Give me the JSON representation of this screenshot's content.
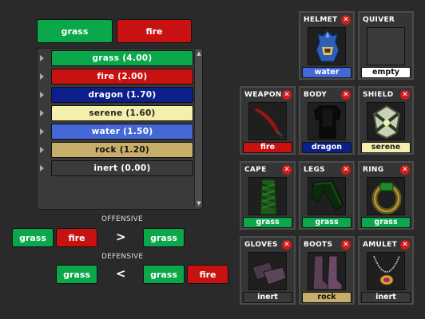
{
  "top_buttons": [
    {
      "label": "grass",
      "color": "#0aa84b"
    },
    {
      "label": "fire",
      "color": "#c81111"
    }
  ],
  "elements": [
    {
      "label": "grass (4.00)",
      "color": "#0aa84b",
      "text_color": "#ffffff"
    },
    {
      "label": "fire (2.00)",
      "color": "#c81111",
      "text_color": "#ffffff"
    },
    {
      "label": "dragon (1.70)",
      "color": "#0d1f8a",
      "text_color": "#ffffff"
    },
    {
      "label": "serene (1.60)",
      "color": "#f3efad",
      "text_color": "#222222"
    },
    {
      "label": "water (1.50)",
      "color": "#4468d8",
      "text_color": "#ffffff"
    },
    {
      "label": "rock (1.20)",
      "color": "#c7ae6a",
      "text_color": "#111111"
    },
    {
      "label": "inert (0.00)",
      "color": "#3a3a3a",
      "text_color": "#ffffff"
    }
  ],
  "offensive": {
    "label": "OFFENSIVE",
    "left": [
      "grass",
      "fire"
    ],
    "operator": ">",
    "right": [
      "grass"
    ]
  },
  "defensive": {
    "label": "DEFENSIVE",
    "left": [
      "grass"
    ],
    "operator": "<",
    "right": [
      "grass",
      "fire"
    ]
  },
  "slots": [
    {
      "name": "HELMET",
      "tag": "water",
      "tag_color": "#4468d8",
      "tag_text": "#ffffff",
      "removable": true,
      "icon": "helmet-icon"
    },
    {
      "name": "QUIVER",
      "tag": "empty",
      "tag_color": "#ffffff",
      "tag_text": "#111111",
      "removable": false,
      "icon": "empty-slot"
    },
    {
      "name": "WEAPON",
      "tag": "fire",
      "tag_color": "#c81111",
      "tag_text": "#ffffff",
      "removable": true,
      "icon": "sword-icon"
    },
    {
      "name": "BODY",
      "tag": "dragon",
      "tag_color": "#0d1f8a",
      "tag_text": "#ffffff",
      "removable": true,
      "icon": "body-armor-icon"
    },
    {
      "name": "SHIELD",
      "tag": "serene",
      "tag_color": "#f3efad",
      "tag_text": "#222222",
      "removable": true,
      "icon": "shield-icon"
    },
    {
      "name": "CAPE",
      "tag": "grass",
      "tag_color": "#0aa84b",
      "tag_text": "#ffffff",
      "removable": true,
      "icon": "cape-icon"
    },
    {
      "name": "LEGS",
      "tag": "grass",
      "tag_color": "#0aa84b",
      "tag_text": "#ffffff",
      "removable": true,
      "icon": "legs-icon"
    },
    {
      "name": "RING",
      "tag": "grass",
      "tag_color": "#0aa84b",
      "tag_text": "#ffffff",
      "removable": true,
      "icon": "ring-icon"
    },
    {
      "name": "GLOVES",
      "tag": "inert",
      "tag_color": "#3a3a3a",
      "tag_text": "#ffffff",
      "removable": true,
      "icon": "gloves-icon"
    },
    {
      "name": "BOOTS",
      "tag": "rock",
      "tag_color": "#c7ae6a",
      "tag_text": "#111111",
      "removable": true,
      "icon": "boots-icon"
    },
    {
      "name": "AMULET",
      "tag": "inert",
      "tag_color": "#3a3a3a",
      "tag_text": "#ffffff",
      "removable": true,
      "icon": "amulet-icon"
    }
  ],
  "close_glyph": "✕"
}
